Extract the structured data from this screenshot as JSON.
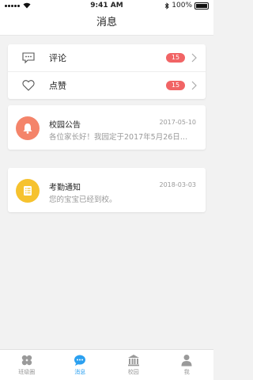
{
  "status_bar": {
    "time": "9:41 AM",
    "battery": "100%"
  },
  "nav": {
    "title": "消息"
  },
  "quick_rows": [
    {
      "label": "评论",
      "badge": "15"
    },
    {
      "label": "点赞",
      "badge": "15"
    }
  ],
  "messages": [
    {
      "title": "校园公告",
      "date": "2017-05-10",
      "body": "各位家长好！我园定于2017年5月26日…",
      "color": "#f4846a"
    },
    {
      "title": "考勤通知",
      "date": "2018-03-03",
      "body": "您的宝宝已经到校。",
      "color": "#f6c22e"
    }
  ],
  "tabs": [
    {
      "label": "班级圈"
    },
    {
      "label": "消息"
    },
    {
      "label": "校园"
    },
    {
      "label": "我"
    }
  ],
  "colors": {
    "accent": "#2ba0f0",
    "badge": "#f16465"
  }
}
